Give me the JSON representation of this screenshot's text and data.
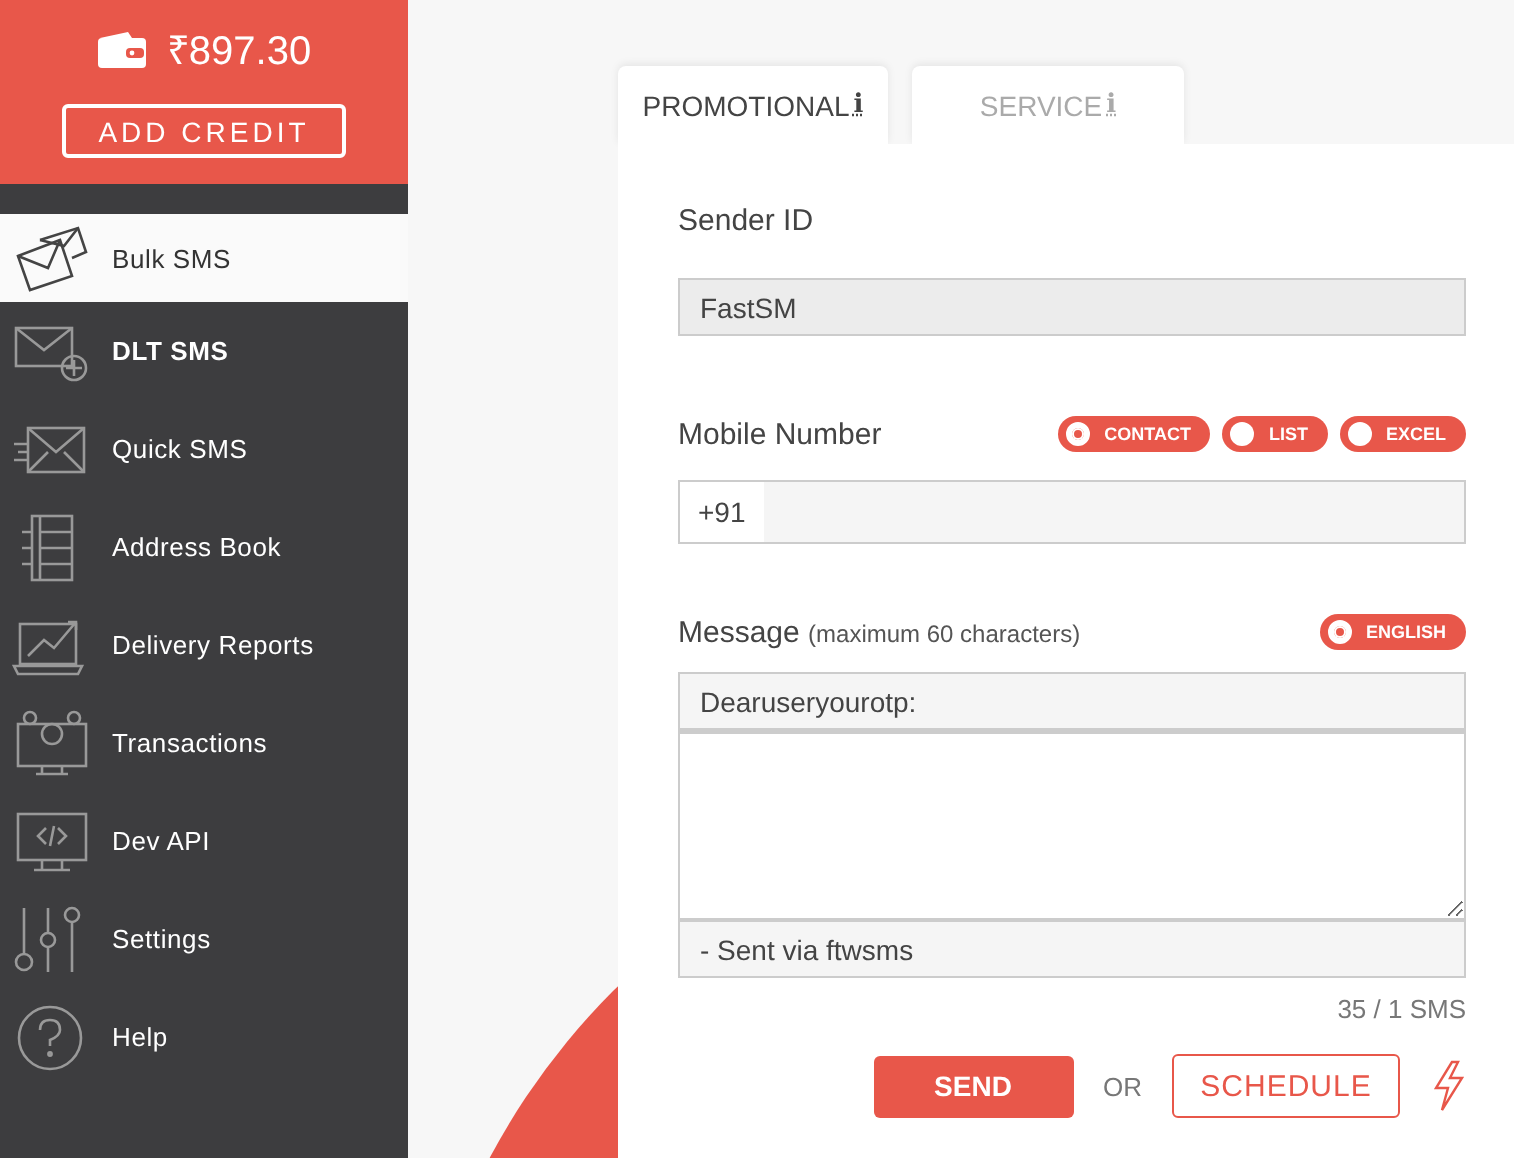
{
  "sidebar": {
    "balance": "₹897.30",
    "add_credit": "ADD CREDIT",
    "items": [
      {
        "label": "Bulk SMS",
        "selected": true,
        "emphasized": false
      },
      {
        "label": "DLT SMS",
        "selected": false,
        "emphasized": true
      },
      {
        "label": "Quick SMS",
        "selected": false,
        "emphasized": false
      },
      {
        "label": "Address Book",
        "selected": false,
        "emphasized": false
      },
      {
        "label": "Delivery Reports",
        "selected": false,
        "emphasized": false
      },
      {
        "label": "Transactions",
        "selected": false,
        "emphasized": false
      },
      {
        "label": "Dev API",
        "selected": false,
        "emphasized": false
      },
      {
        "label": "Settings",
        "selected": false,
        "emphasized": false
      },
      {
        "label": "Help",
        "selected": false,
        "emphasized": false
      }
    ]
  },
  "tabs": [
    {
      "label": "PROMOTIONAL",
      "info": "i",
      "selected": true
    },
    {
      "label": "SERVICE",
      "info": "i",
      "selected": false
    }
  ],
  "form": {
    "sender_label": "Sender ID",
    "sender_value": "FastSM",
    "mobile_label": "Mobile Number",
    "mobile_sources": [
      {
        "label": "CONTACT",
        "selected": true
      },
      {
        "label": "LIST",
        "selected": false
      },
      {
        "label": "EXCEL",
        "selected": false
      }
    ],
    "country_code": "+91",
    "message_label": "Message",
    "message_hint": "(maximum 60 characters)",
    "languages": [
      {
        "label": "ENGLISH",
        "selected": true
      }
    ],
    "message_prefix": "Dearuseryourotp:",
    "message_suffix": "- Sent via ftwsms",
    "counter": "35 / 1 SMS",
    "send": "SEND",
    "or": "OR",
    "schedule": "SCHEDULE"
  }
}
